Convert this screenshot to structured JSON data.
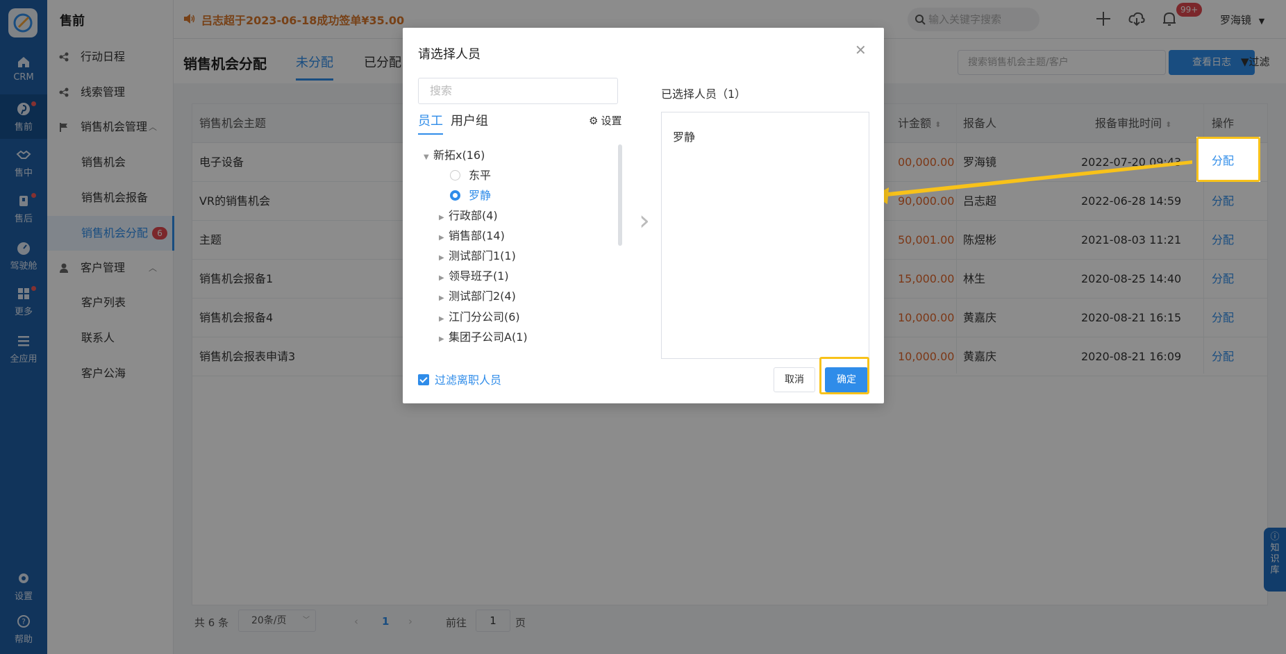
{
  "rail": {
    "items": [
      {
        "label": "CRM",
        "icon": "home-icon"
      },
      {
        "label": "售前",
        "icon": "pinterest-icon"
      },
      {
        "label": "售中",
        "icon": "handshake-icon"
      },
      {
        "label": "售后",
        "icon": "clipboard-icon"
      },
      {
        "label": "驾驶舱",
        "icon": "dashboard-icon"
      },
      {
        "label": "更多",
        "icon": "grid-icon"
      },
      {
        "label": "全应用",
        "icon": "menu-icon"
      }
    ],
    "settings": "设置",
    "help": "帮助"
  },
  "sidebar": {
    "title": "售前",
    "items": [
      {
        "label": "行动日程"
      },
      {
        "label": "线索管理"
      },
      {
        "label": "销售机会管理"
      },
      {
        "label": "销售机会"
      },
      {
        "label": "销售机会报备"
      },
      {
        "label": "销售机会分配",
        "badge": "6"
      },
      {
        "label": "客户管理"
      },
      {
        "label": "客户列表"
      },
      {
        "label": "联系人"
      },
      {
        "label": "客户公海"
      }
    ]
  },
  "topbar": {
    "notice": "吕志超于2023-06-18成功签单¥35.00",
    "search_placeholder": "输入关键字搜索",
    "notification_count": "99+",
    "user": "罗海镜"
  },
  "page": {
    "title": "销售机会分配",
    "tabs": [
      "未分配",
      "已分配"
    ],
    "search_placeholder": "搜索销售机会主题/客户",
    "log_button": "查看日志",
    "filter": "过滤"
  },
  "table": {
    "headers": {
      "subject": "销售机会主题",
      "amount": "计金额",
      "reporter": "报备人",
      "approve_time": "报备审批时间",
      "action": "操作"
    },
    "rows": [
      {
        "subject": "电子设备",
        "amount": "00,000.00",
        "reporter": "罗海镜",
        "time": "2022-07-20 09:43",
        "action": "分配"
      },
      {
        "subject": "VR的销售机会",
        "amount": "90,000.00",
        "reporter": "吕志超",
        "time": "2022-06-28 14:59",
        "action": "分配"
      },
      {
        "subject": "主题",
        "amount": "50,001.00",
        "reporter": "陈煜彬",
        "time": "2021-08-03 11:21",
        "action": "分配"
      },
      {
        "subject": "销售机会报备1",
        "amount": "15,000.00",
        "reporter": "林生",
        "time": "2020-08-25 14:40",
        "action": "分配"
      },
      {
        "subject": "销售机会报备4",
        "amount": "10,000.00",
        "reporter": "黄嘉庆",
        "time": "2020-08-21 16:15",
        "action": "分配"
      },
      {
        "subject": "销售机会报表申请3",
        "amount": "10,000.00",
        "reporter": "黄嘉庆",
        "time": "2020-08-21 16:09",
        "action": "分配"
      }
    ]
  },
  "pager": {
    "total": "共 6 条",
    "page_size": "20条/页",
    "current": "1",
    "goto_prefix": "前往",
    "goto_value": "1",
    "goto_suffix": "页"
  },
  "knowledge_base": "知识库",
  "modal": {
    "title": "请选择人员",
    "search_placeholder": "搜索",
    "tabs": [
      "员工",
      "用户组"
    ],
    "settings": "设置",
    "tree": {
      "root": "新拓x(16)",
      "people": [
        {
          "name": "东平",
          "selected": false
        },
        {
          "name": "罗静",
          "selected": true
        }
      ],
      "groups": [
        "行政部(4)",
        "销售部(14)",
        "测试部门1(1)",
        "领导班子(1)",
        "测试部门2(4)",
        "江门分公司(6)",
        "集团子公司A(1)"
      ]
    },
    "selected_header": "已选择人员（1）",
    "selected": [
      "罗静"
    ],
    "filter_resigned": "过滤离职人员",
    "cancel": "取消",
    "confirm": "确定"
  },
  "colors": {
    "primary": "#2f8ce9",
    "rail": "#1f5fa6",
    "amount": "#e2662a",
    "highlight": "#f8c21a"
  }
}
